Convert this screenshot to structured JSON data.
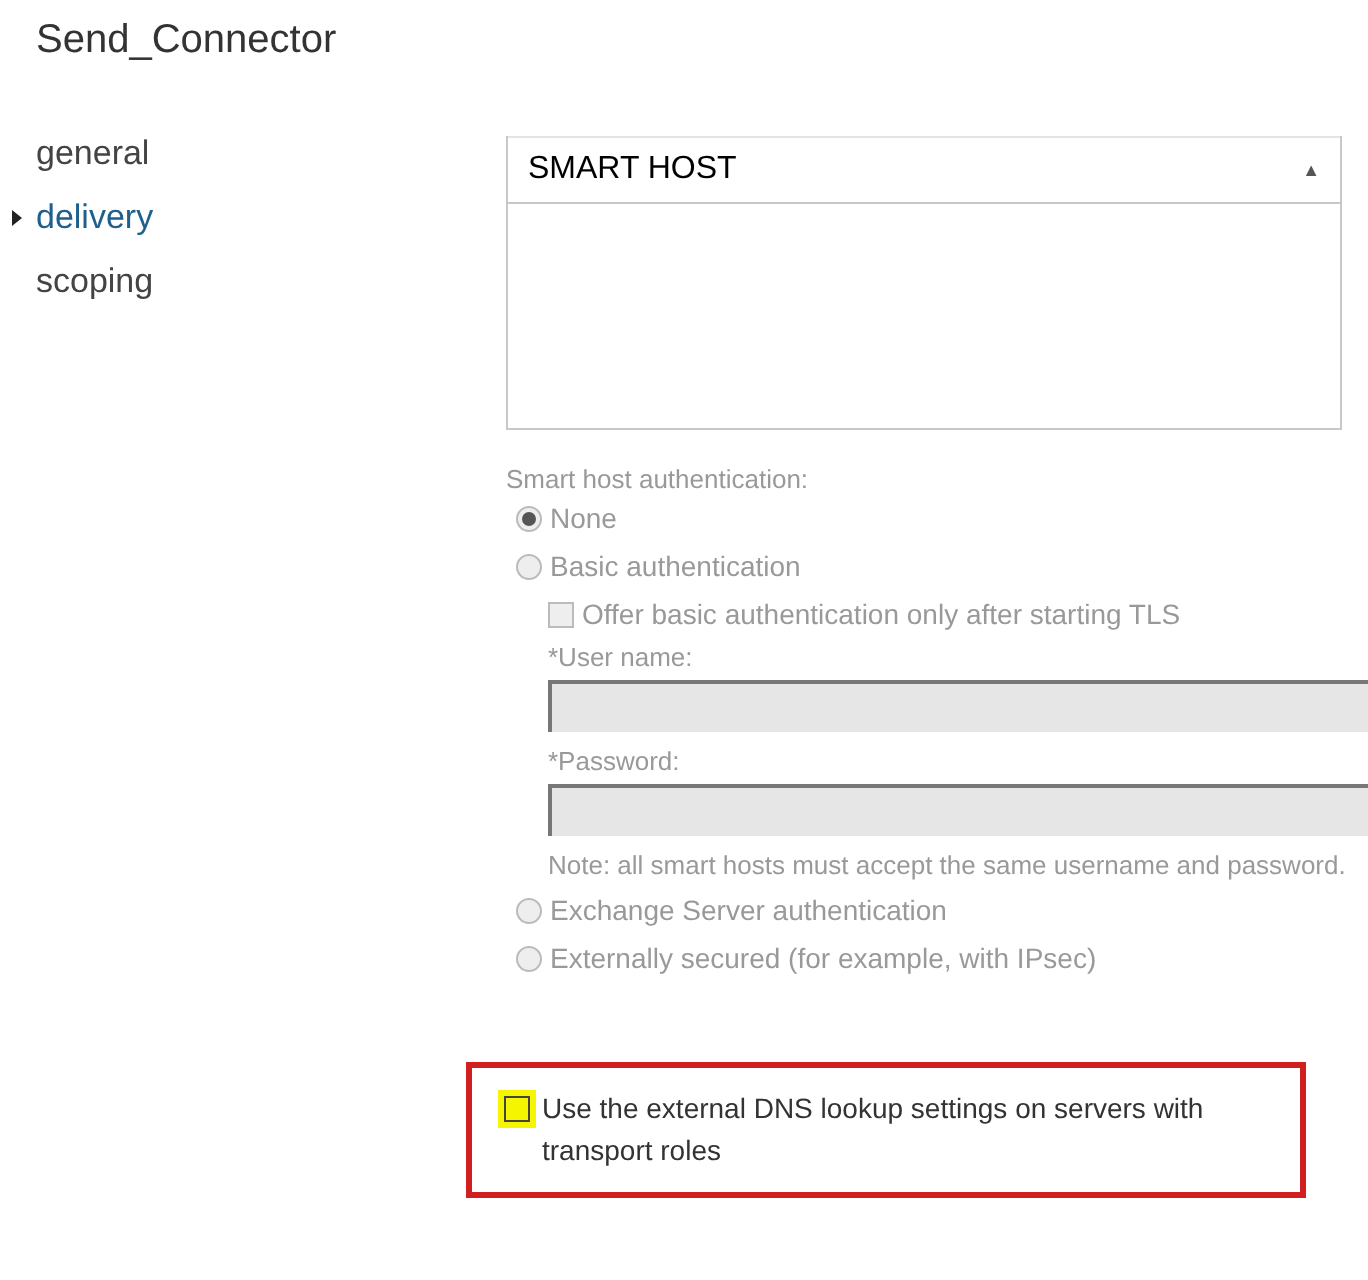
{
  "title": "Send_Connector",
  "nav": [
    {
      "label": "general",
      "selected": false
    },
    {
      "label": "delivery",
      "selected": true
    },
    {
      "label": "scoping",
      "selected": false
    }
  ],
  "smart_host_table": {
    "column": "SMART HOST",
    "sort_indicator": "▲"
  },
  "auth_label": "Smart host authentication:",
  "auth_options": [
    {
      "label": "None",
      "selected": true,
      "disabled": true,
      "kind": "radio"
    },
    {
      "label": "Basic authentication",
      "selected": false,
      "disabled": true,
      "kind": "radio"
    },
    {
      "kind": "basic_details",
      "tls_checkbox": {
        "label": "Offer basic authentication only after starting TLS",
        "checked": false,
        "disabled": true
      },
      "user_label": "*User name:",
      "password_label": "*Password:",
      "note": "Note: all smart hosts must accept the same username and password."
    },
    {
      "label": "Exchange Server authentication",
      "selected": false,
      "disabled": true,
      "kind": "radio"
    },
    {
      "label": "Externally secured (for example, with IPsec)",
      "selected": false,
      "disabled": true,
      "kind": "radio"
    }
  ],
  "dns_checkbox": {
    "label": "Use the external DNS lookup settings on servers with transport roles",
    "checked": false,
    "highlighted": true
  }
}
